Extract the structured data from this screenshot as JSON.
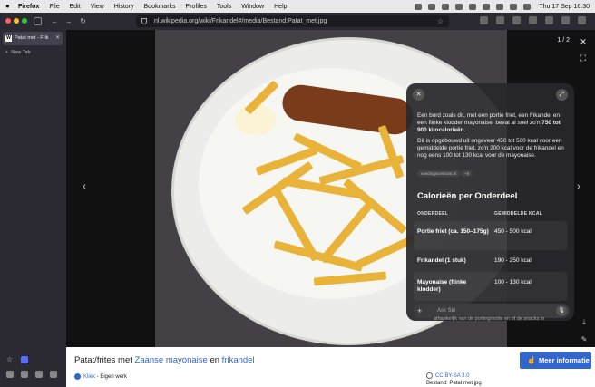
{
  "menubar": {
    "apple": "",
    "items": [
      "Firefox",
      "File",
      "Edit",
      "View",
      "History",
      "Bookmarks",
      "Profiles",
      "Tools",
      "Window",
      "Help"
    ],
    "clock": "Thu 17 Sep  16:30"
  },
  "toolbar": {
    "url": "nl.wikipedia.org/wiki/Frikandel#/media/Bestand:Patat_met.jpg"
  },
  "sidebar": {
    "tab_title": "Patat met - Frik",
    "tab_favicon": "W",
    "new_tab": "New Tab"
  },
  "viewer": {
    "counter": "1 / 2",
    "prev_icon": "‹",
    "next_icon": "›"
  },
  "panel": {
    "intro": "Een bord zoals dit, met een portie friet, een frikandel en een flinke klodder mayonaise, bevat al snel zo'n",
    "intro_bold": "750 tot 900 kilocalorieën.",
    "detail": "Dit is opgebouwd uit ongeveer 450 tot 500 kcal voor een gemiddelde portie friet, zo'n 200 kcal voor de frikandel en nog eens 100 tot 130 kcal voor de mayonaise.",
    "source": "voedingscentrum.nl",
    "source_more": "+6",
    "table_title": "Calorieën per Onderdeel",
    "col1": "ONDERDEEL",
    "col2": "GEMIDDELDE KCAL",
    "rows": [
      {
        "part": "Portie friet (ca. 150–175g)",
        "kcal": "450 - 500 kcal"
      },
      {
        "part": "Frikandel (1 stuk)",
        "kcal": "190 - 250 kcal"
      },
      {
        "part": "Mayonaise (flinke klodder)",
        "kcal": "100 - 130 kcal"
      }
    ],
    "ask_placeholder": "Ask Siri",
    "tail_text": "afhankelijk van de portiegrootte en of de snacks in"
  },
  "caption": {
    "prefix": "Patat/frites met ",
    "link1": "Zaanse mayonaise",
    "middle": " en ",
    "link2": "frikandel",
    "author_name": "Kliek",
    "author_suffix": " - Eigen werk",
    "license": "CC BY-SA 3.0",
    "file": "Bestand: Patat met.jpg",
    "more_button": "Meer informatie"
  },
  "colors": {
    "accent": "#3366cc",
    "panel_bg": "#28282c",
    "browser_bg": "#2b2a33"
  }
}
